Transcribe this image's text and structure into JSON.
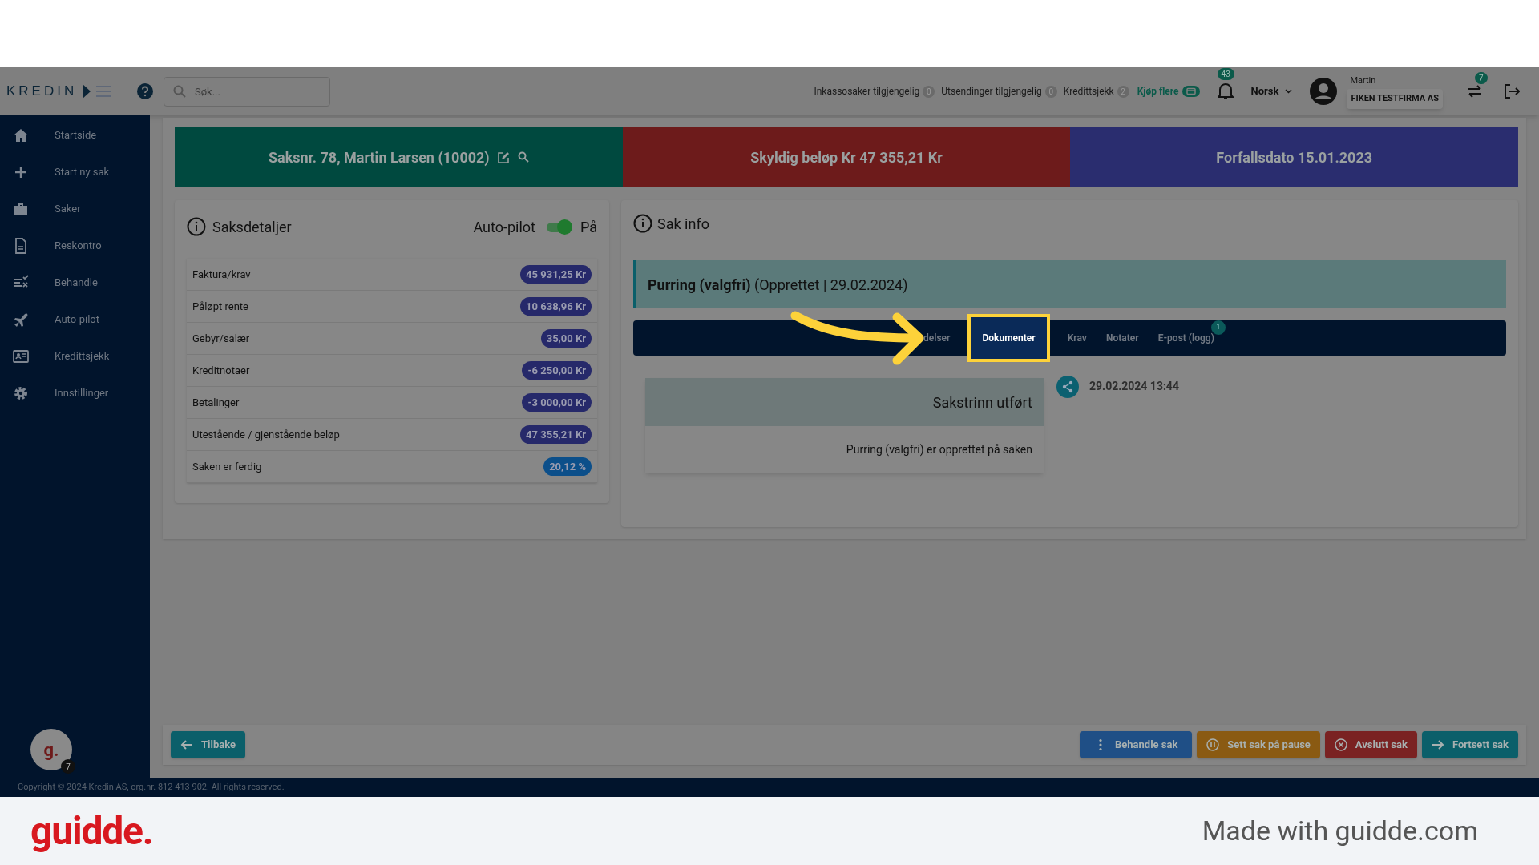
{
  "header": {
    "logo": "KREDIN",
    "search": {
      "placeholder": "Søk..."
    },
    "counters": [
      {
        "label": "Inkassosaker tilgjengelig",
        "count": "0"
      },
      {
        "label": "Utsendinger tilgjengelig",
        "count": "0"
      },
      {
        "label": "Kredittsjekk",
        "count": "2"
      }
    ],
    "buy_more": "Kjøp flere",
    "notifications_count": "43",
    "language": "Norsk",
    "user": {
      "name": "Martin",
      "company": "FIKEN TESTFIRMA AS"
    },
    "switch_count": "7"
  },
  "sidebar": {
    "items": [
      {
        "label": "Startside",
        "kind": "home"
      },
      {
        "label": "Start ny sak",
        "kind": "new"
      },
      {
        "label": "Saker",
        "kind": "cases"
      },
      {
        "label": "Reskontro",
        "kind": "ledger"
      },
      {
        "label": "Behandle",
        "kind": "process"
      },
      {
        "label": "Auto-pilot",
        "kind": "autopilot"
      },
      {
        "label": "Kredittsjekk",
        "kind": "creditcheck"
      },
      {
        "label": "Innstillinger",
        "kind": "settings"
      }
    ],
    "avatar": {
      "letter": "g.",
      "badge": "7"
    }
  },
  "banners": [
    {
      "kind": "case",
      "text": "Saksnr. 78, Martin Larsen (10002)"
    },
    {
      "kind": "amount",
      "text": "Skyldig beløp Kr 47 355,21 Kr"
    },
    {
      "kind": "due",
      "text": "Forfallsdato 15.01.2023"
    }
  ],
  "details": {
    "title": "Saksdetaljer",
    "autopilot": {
      "label": "Auto-pilot",
      "on": true,
      "state_label": "På"
    },
    "rows": [
      {
        "label": "Faktura/krav",
        "value": "45 931,25 Kr",
        "kind": "amount"
      },
      {
        "label": "Påløpt rente",
        "value": "10 638,96 Kr",
        "kind": "amount"
      },
      {
        "label": "Gebyr/salær",
        "value": "35,00 Kr",
        "kind": "amount"
      },
      {
        "label": "Kreditnotaer",
        "value": "-6 250,00 Kr",
        "kind": "amount"
      },
      {
        "label": "Betalinger",
        "value": "-3 000,00 Kr",
        "kind": "amount"
      },
      {
        "label": "Utestående / gjenstående beløp",
        "value": "47 355,21 Kr",
        "kind": "amount"
      },
      {
        "label": "Saken er ferdig",
        "value": "20,12 %",
        "kind": "percent"
      }
    ]
  },
  "case_info": {
    "title": "Sak info",
    "step": {
      "name": "Purring (valgfri)",
      "status": "(Opprettet | 29.02.2024)"
    },
    "tabs": [
      {
        "label": "delser",
        "selected": false
      },
      {
        "label": "Dokumenter",
        "selected": true
      },
      {
        "label": "Krav",
        "selected": false
      },
      {
        "label": "Notater",
        "selected": false
      },
      {
        "label": "E-post (logg)",
        "selected": false,
        "badge": "1"
      }
    ],
    "entry": {
      "time": "29.02.2024 13:44",
      "title": "Sakstrinn utført",
      "text": "Purring (valgfri) er opprettet på saken"
    }
  },
  "actions": [
    {
      "label": "Tilbake",
      "kind": "back"
    },
    {
      "label": "Behandle sak",
      "kind": "process"
    },
    {
      "label": "Sett sak på pause",
      "kind": "pause"
    },
    {
      "label": "Avslutt sak",
      "kind": "close"
    },
    {
      "label": "Fortsett sak",
      "kind": "continue"
    }
  ],
  "copyright": "Copyright © 2024 Kredin AS, org.nr. 812 413 902. All rights reserved.",
  "guidde_bar": {
    "logo": "guidde.",
    "caption": "Made with guidde.com"
  }
}
